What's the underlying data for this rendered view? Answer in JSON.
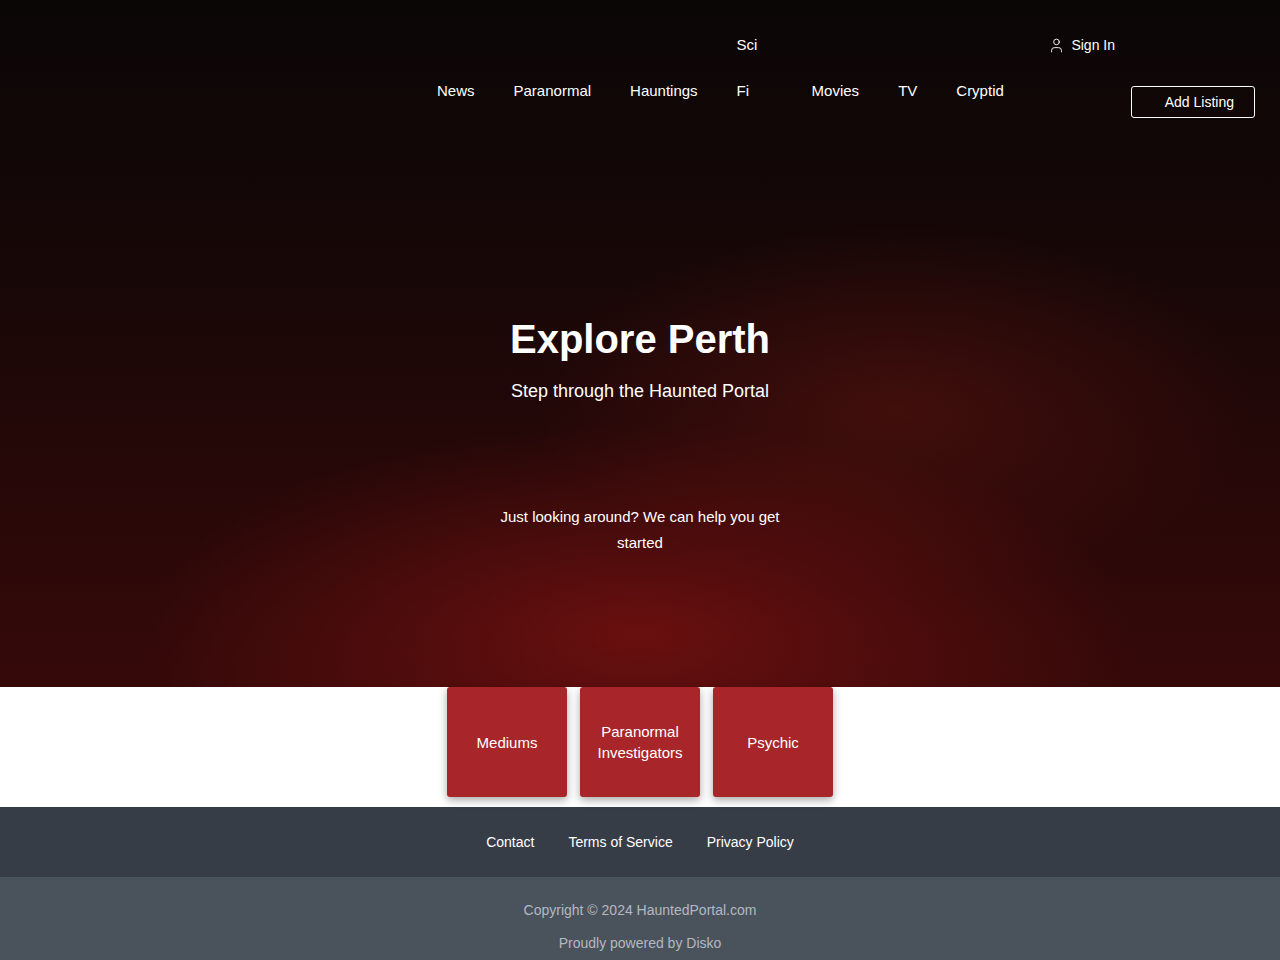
{
  "header": {
    "nav": [
      {
        "label": "News"
      },
      {
        "label": "Paranormal"
      },
      {
        "label": "Hauntings"
      },
      {
        "label": "Sci Fi",
        "wrapped": true
      },
      {
        "label": "Movies"
      },
      {
        "label": "TV"
      },
      {
        "label": "Cryptid"
      }
    ],
    "sign_in": "Sign In",
    "add_listing": "Add Listing"
  },
  "hero": {
    "title": "Explore Perth",
    "subtitle": "Step through the Haunted Portal",
    "help": "Just looking around? We can help you get started"
  },
  "categories": [
    {
      "label": "Mediums"
    },
    {
      "label": "Paranormal Investigators"
    },
    {
      "label": "Psychic"
    }
  ],
  "footer": {
    "links": [
      "Contact",
      "Terms of Service",
      "Privacy Policy"
    ],
    "copyright": "Copyright © 2024 HauntedPortal.com",
    "powered_by": "Proudly powered by Disko"
  }
}
